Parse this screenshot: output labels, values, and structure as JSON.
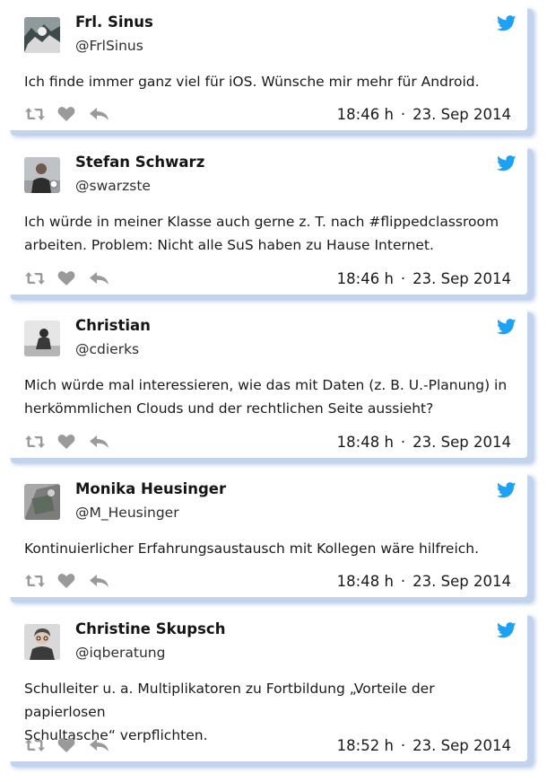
{
  "colors": {
    "twitter_blue": "#1da1f2",
    "action_gray": "#9a9a9a",
    "shadow_blue": "#a7bfe6"
  },
  "icons": {
    "brand": "twitter-bird-icon",
    "retweet": "retweet-icon",
    "like": "heart-icon",
    "reply": "reply-icon"
  },
  "tweets": [
    {
      "name": "Frl. Sinus",
      "handle": "@FrlSinus",
      "lines": [
        "Ich finde immer ganz viel für iOS. Wünsche mir mehr für Android."
      ],
      "time": "18:46 h",
      "date": "23. Sep 2014"
    },
    {
      "name": "Stefan Schwarz",
      "handle": "@swarzste",
      "lines": [
        "Ich würde in meiner Klasse auch gerne z. T. nach #flippedclassroom",
        "arbeiten. Problem: Nicht alle SuS haben zu Hause Internet."
      ],
      "time": "18:46 h",
      "date": "23. Sep 2014"
    },
    {
      "name": "Christian",
      "handle": "@cdierks",
      "lines": [
        "Mich würde mal interessieren, wie das mit Daten (z. B. U.-Planung) in",
        "herkömmlichen Clouds und der rechtlichen Seite aussieht?"
      ],
      "time": "18:48 h",
      "date": "23. Sep 2014"
    },
    {
      "name": "Monika Heusinger",
      "handle": "@M_Heusinger",
      "lines": [
        "Kontinuierlicher Erfahrungsaustausch mit Kollegen wäre hilfreich."
      ],
      "time": "18:48 h",
      "date": "23. Sep 2014"
    },
    {
      "name": "Christine Skupsch",
      "handle": "@iqberatung",
      "lines": [
        "Schulleiter u. a. Multiplikatoren zu Fortbildung „Vorteile der papierlosen",
        "Schultasche“ verpflichten."
      ],
      "time": "18:52 h",
      "date": "23. Sep 2014"
    }
  ]
}
